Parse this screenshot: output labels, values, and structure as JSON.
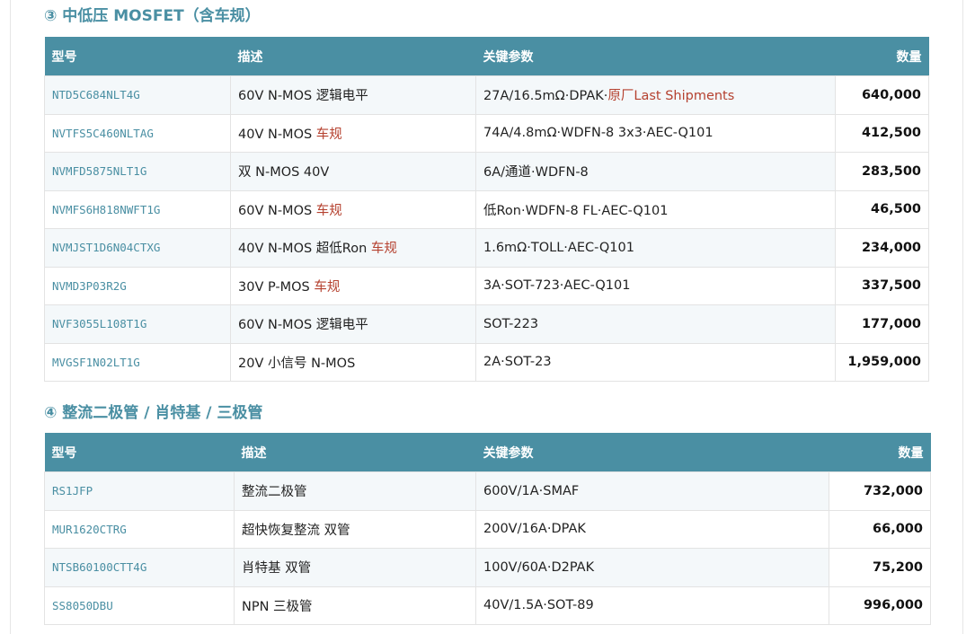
{
  "colors": {
    "accent": "#4a8fa3",
    "highlight_red": "#b5412f",
    "row_alt": "#f4f8fa"
  },
  "sections": [
    {
      "title": "③ 中低压 MOSFET（含车规）",
      "headers": {
        "model": "型号",
        "desc": "描述",
        "params": "关键参数",
        "qty": "数量"
      },
      "rows": [
        {
          "model": "NTD5C684NLT4G",
          "desc": "60V N-MOS 逻辑电平",
          "desc_tag": "",
          "params": "27A/16.5mΩ·DPAK·",
          "params_tag": "原厂Last Shipments",
          "qty": "640,000"
        },
        {
          "model": "NVTFS5C460NLTAG",
          "desc": "40V N-MOS ",
          "desc_tag": "车规",
          "params": "74A/4.8mΩ·WDFN-8 3x3·AEC-Q101",
          "params_tag": "",
          "qty": "412,500"
        },
        {
          "model": "NVMFD5875NLT1G",
          "desc": "双 N-MOS 40V",
          "desc_tag": "",
          "params": "6A/通道·WDFN-8",
          "params_tag": "",
          "qty": "283,500"
        },
        {
          "model": "NVMFS6H818NWFT1G",
          "desc": "60V N-MOS ",
          "desc_tag": "车规",
          "params": "低Ron·WDFN-8 FL·AEC-Q101",
          "params_tag": "",
          "qty": "46,500"
        },
        {
          "model": "NVMJST1D6N04CTXG",
          "desc": "40V N-MOS 超低Ron ",
          "desc_tag": "车规",
          "params": "1.6mΩ·TOLL·AEC-Q101",
          "params_tag": "",
          "qty": "234,000"
        },
        {
          "model": "NVMD3P03R2G",
          "desc": "30V P-MOS ",
          "desc_tag": "车规",
          "params": "3A·SOT-723·AEC-Q101",
          "params_tag": "",
          "qty": "337,500"
        },
        {
          "model": "NVF3055L108T1G",
          "desc": "60V N-MOS 逻辑电平",
          "desc_tag": "",
          "params": "SOT-223",
          "params_tag": "",
          "qty": "177,000"
        },
        {
          "model": "MVGSF1N02LT1G",
          "desc": "20V 小信号 N-MOS",
          "desc_tag": "",
          "params": "2A·SOT-23",
          "params_tag": "",
          "qty": "1,959,000"
        }
      ]
    },
    {
      "title": "④ 整流二极管 / 肖特基 / 三极管",
      "headers": {
        "model": "型号",
        "desc": "描述",
        "params": "关键参数",
        "qty": "数量"
      },
      "rows": [
        {
          "model": "RS1JFP",
          "desc": "整流二极管",
          "desc_tag": "",
          "params": "600V/1A·SMAF",
          "params_tag": "",
          "qty": "732,000"
        },
        {
          "model": "MUR1620CTRG",
          "desc": "超快恢复整流 双管",
          "desc_tag": "",
          "params": "200V/16A·DPAK",
          "params_tag": "",
          "qty": "66,000"
        },
        {
          "model": "NTSB60100CTT4G",
          "desc": "肖特基 双管",
          "desc_tag": "",
          "params": "100V/60A·D2PAK",
          "params_tag": "",
          "qty": "75,200"
        },
        {
          "model": "SS8050DBU",
          "desc": "NPN 三极管",
          "desc_tag": "",
          "params": "40V/1.5A·SOT-89",
          "params_tag": "",
          "qty": "996,000"
        }
      ]
    }
  ]
}
